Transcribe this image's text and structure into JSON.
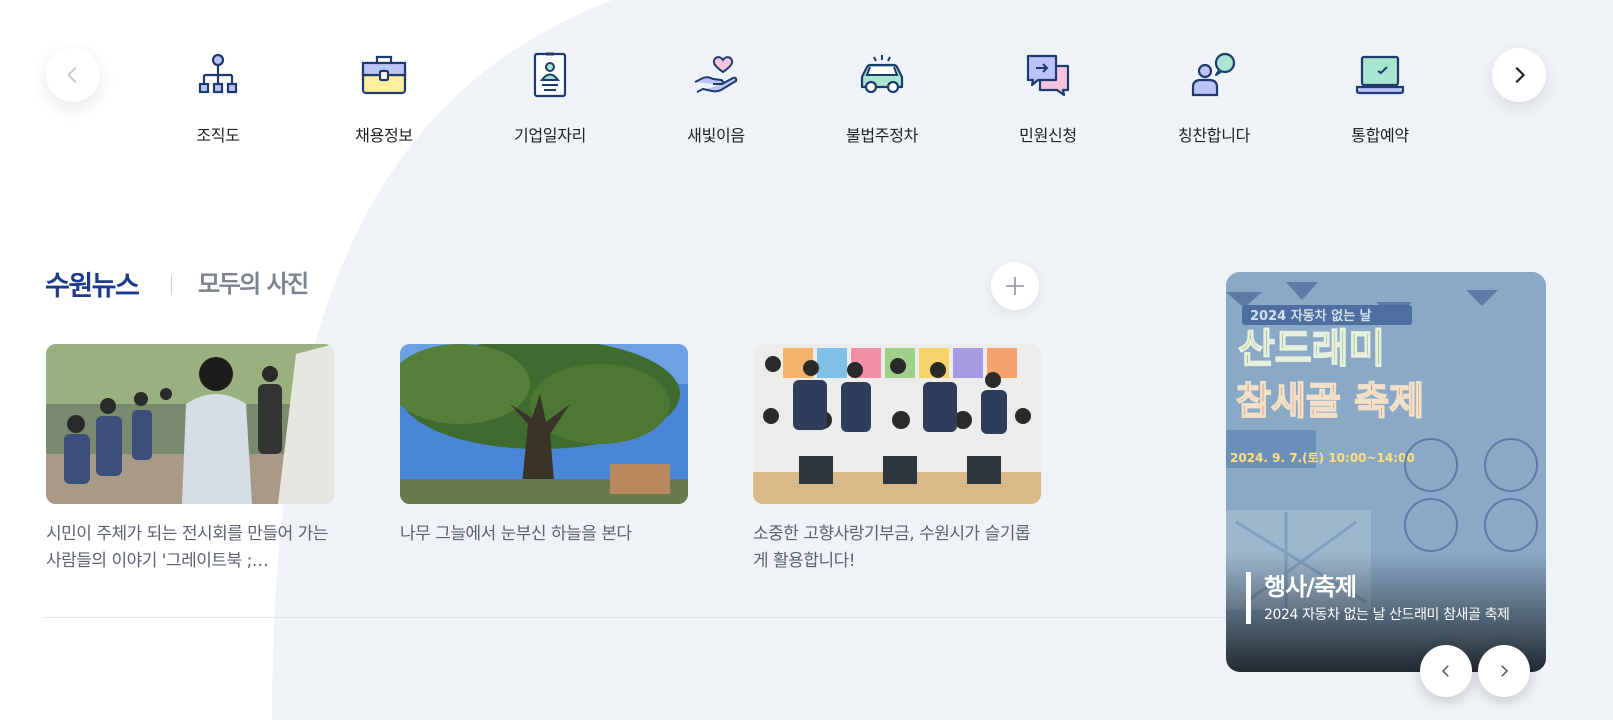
{
  "quick_menu": {
    "prev_icon": "chevron-left-icon",
    "next_icon": "chevron-right-icon",
    "items": [
      {
        "label": "조직도",
        "icon": "org-chart-icon"
      },
      {
        "label": "채용정보",
        "icon": "briefcase-icon"
      },
      {
        "label": "기업일자리",
        "icon": "id-badge-icon"
      },
      {
        "label": "새빛이음",
        "icon": "heart-hand-icon"
      },
      {
        "label": "불법주정차",
        "icon": "car-icon"
      },
      {
        "label": "민원신청",
        "icon": "chat-bubbles-icon"
      },
      {
        "label": "칭찬합니다",
        "icon": "person-speech-icon"
      },
      {
        "label": "통합예약",
        "icon": "laptop-icon"
      }
    ]
  },
  "news": {
    "tab_active": "수원뉴스",
    "tab_other": "모두의 사진",
    "more_icon": "plus-icon",
    "cards": [
      {
        "caption": "시민이 주체가 되는 전시회를 만들어 가는 사람들의 이야기 '그레이트북 ;…"
      },
      {
        "caption": "나무 그늘에서 눈부신 하늘을 본다"
      },
      {
        "caption": "소중한 고향사랑기부금, 수원시가 슬기롭게 활용합니다!"
      }
    ]
  },
  "banner": {
    "category": "행사/축제",
    "description": "2024 자동차 없는 날 산드래미 참새골 축제",
    "poster": {
      "subtitle": "2024 자동차 없는 날",
      "title_line1": "산드래미",
      "title_line2": "참새골 축제",
      "date": "2024. 9. 7.(토) 10:00~14:00"
    },
    "prev_icon": "chevron-left-icon",
    "next_icon": "chevron-right-icon"
  },
  "colors": {
    "brand_navy": "#1e3a8a",
    "bg_blob": "#eef3f8",
    "icon_stroke": "#1e3a6e",
    "icon_fill_purple": "#bcc4f5",
    "icon_fill_yellow": "#fdeea0",
    "icon_fill_mint": "#a8e6cf",
    "icon_fill_pink": "#f7c3dd"
  }
}
